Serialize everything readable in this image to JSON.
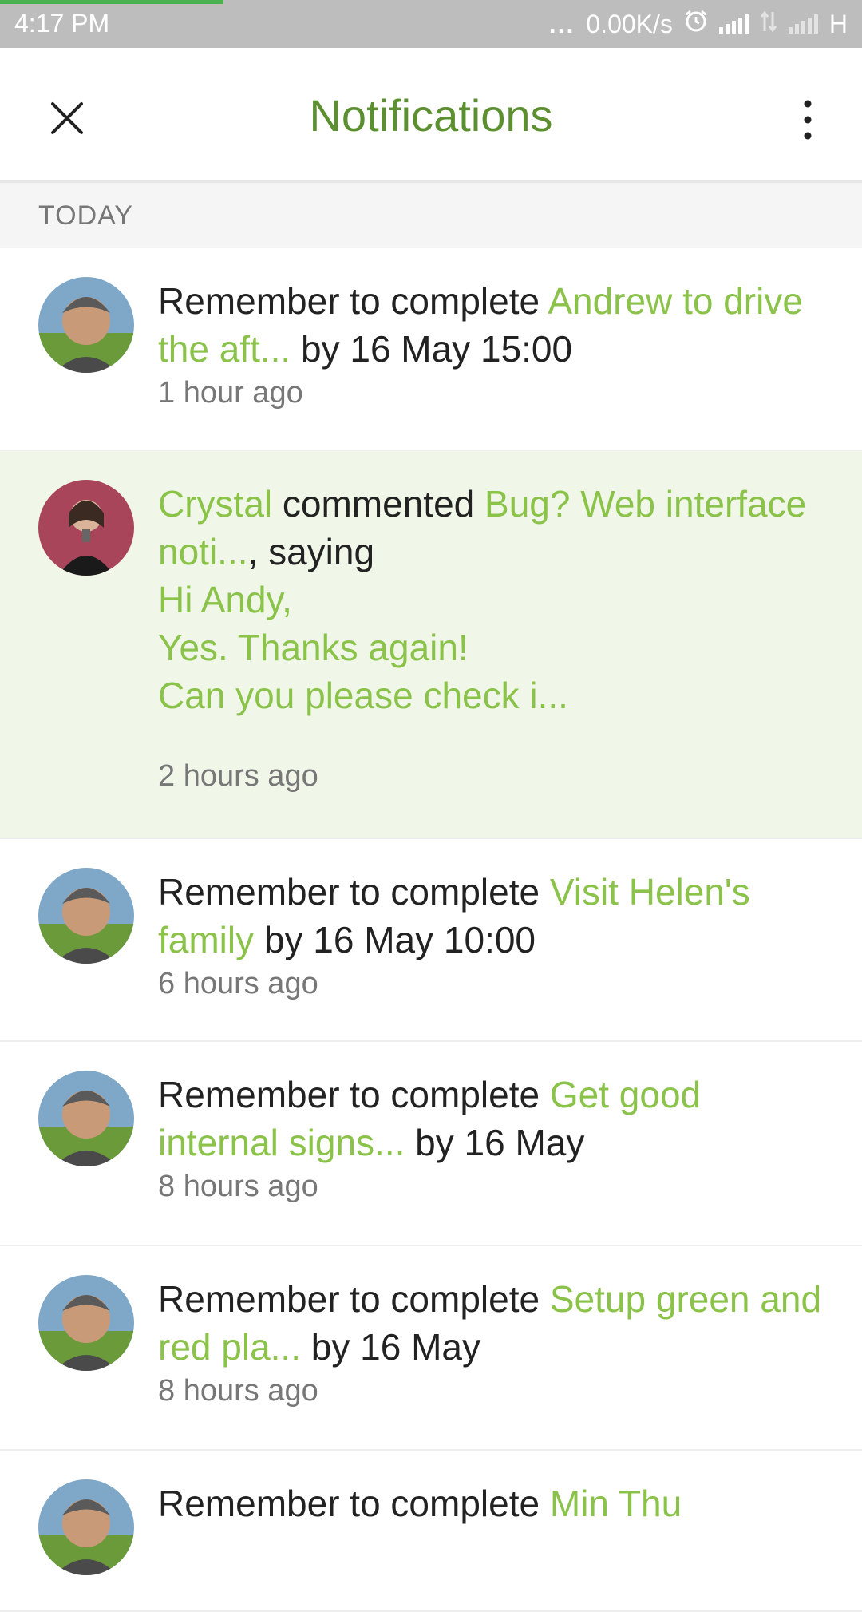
{
  "status_bar": {
    "time": "4:17 PM",
    "dots": "...",
    "speed": "0.00K/s",
    "network": "H"
  },
  "header": {
    "title": "Notifications"
  },
  "section": {
    "label": "TODAY"
  },
  "notifications": [
    {
      "prefix": "Remember to complete ",
      "link": "Andrew to drive the aft...",
      "suffix": " by 16 May 15:00",
      "time": "1 hour ago"
    },
    {
      "author": "Crystal",
      "verb": " commented ",
      "link": "Bug? Web interface noti...",
      "suffix": ", saying",
      "message": [
        "Hi Andy,",
        "Yes. Thanks again!",
        "Can you please check i..."
      ],
      "time": "2 hours ago"
    },
    {
      "prefix": "Remember to complete ",
      "link": "Visit Helen's family",
      "suffix": " by 16 May 10:00",
      "time": "6 hours ago"
    },
    {
      "prefix": "Remember to complete ",
      "link": "Get good internal signs...",
      "suffix": " by 16 May",
      "time": "8 hours ago"
    },
    {
      "prefix": "Remember to complete ",
      "link": "Setup green and red pla...",
      "suffix": " by 16 May",
      "time": "8 hours ago"
    },
    {
      "prefix": "Remember to complete ",
      "link": "Min Thu"
    }
  ],
  "colors": {
    "accent": "#8bc34a",
    "title": "#5b8f2f",
    "highlight_bg": "#f0f7e8",
    "status_bar": "#bdbdbd"
  },
  "icons": {
    "close": "close-icon",
    "more": "more-vertical-icon",
    "alarm": "alarm-icon",
    "signal": "signal-icon",
    "data": "data-transfer-icon"
  }
}
